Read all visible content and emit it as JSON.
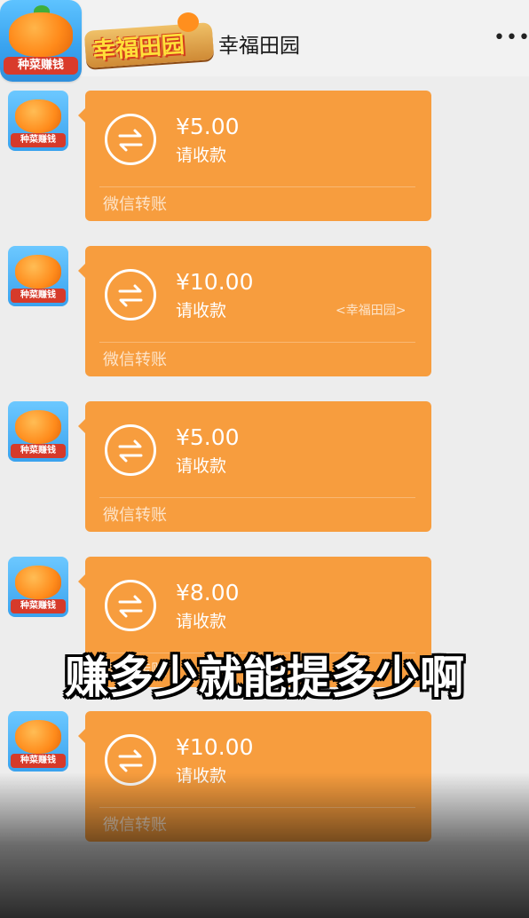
{
  "header": {
    "app_badge": "种菜赚钱",
    "logo_text": "幸福田园",
    "title": "幸福田园",
    "more": "•••"
  },
  "messages": [
    {
      "avatar_badge": "种菜赚钱",
      "amount": "¥5.00",
      "status": "请收款",
      "footer": "微信转账"
    },
    {
      "avatar_badge": "种菜赚钱",
      "amount": "¥10.00",
      "status": "请收款",
      "footer": "微信转账",
      "watermark": "<幸福田园>"
    },
    {
      "avatar_badge": "种菜赚钱",
      "amount": "¥5.00",
      "status": "请收款",
      "footer": "微信转账"
    },
    {
      "avatar_badge": "种菜赚钱",
      "amount": "¥8.00",
      "status": "请收款",
      "footer": "微信转账"
    },
    {
      "avatar_badge": "种菜赚钱",
      "amount": "¥10.00",
      "status": "请收款",
      "footer": "微信转账"
    }
  ],
  "caption": "赚多少就能提多少啊",
  "colors": {
    "bubble": "#f79d3e",
    "background": "#ededed"
  },
  "icons": {
    "transfer": "transfer-arrows-icon",
    "more": "more-dots-icon"
  }
}
